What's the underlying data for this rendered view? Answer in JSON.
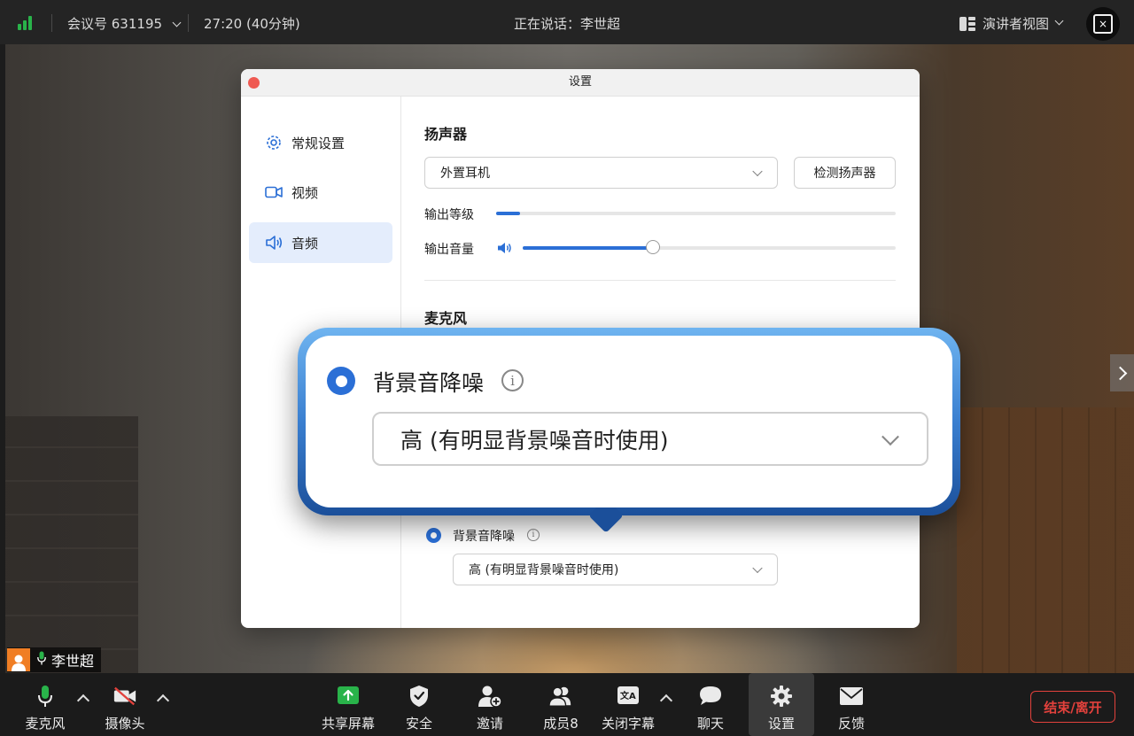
{
  "topbar": {
    "meeting_id": "会议号 631195",
    "duration": "27:20 (40分钟)",
    "speaking": "正在说话：李世超",
    "view_mode": "演讲者视图",
    "icons": [
      "signal-icon",
      "chevron-down-icon",
      "speaker-view-icon",
      "fullscreen-icon"
    ]
  },
  "dialog": {
    "title": "设置",
    "nav": [
      {
        "label": "常规设置",
        "icon": "gear-icon"
      },
      {
        "label": "视频",
        "icon": "camera-icon"
      },
      {
        "label": "音频",
        "icon": "speaker-icon",
        "active": true
      }
    ],
    "speaker": {
      "heading": "扬声器",
      "device": "外置耳机",
      "test_button": "检测扬声器",
      "output_level_label": "输出等级",
      "output_level": 0.06,
      "output_volume_label": "输出音量",
      "output_volume": 0.35
    },
    "mic": {
      "heading": "麦克风",
      "noise_label": "背景音降噪",
      "noise_option": "高 (有明显背景噪音时使用)"
    }
  },
  "callout": {
    "noise_label": "背景音降噪",
    "noise_option": "高 (有明显背景噪音时使用)"
  },
  "nametag": {
    "name": "李世超"
  },
  "toolbar": {
    "mic": "麦克风",
    "camera": "摄像头",
    "share": "共享屏幕",
    "security": "安全",
    "invite": "邀请",
    "members": "成员8",
    "captions": "关闭字幕",
    "chat": "聊天",
    "settings": "设置",
    "feedback": "反馈",
    "end": "结束/离开"
  },
  "colors": {
    "accent": "#2b6fd6",
    "danger": "#e2413c",
    "signal": "#29b34a"
  }
}
